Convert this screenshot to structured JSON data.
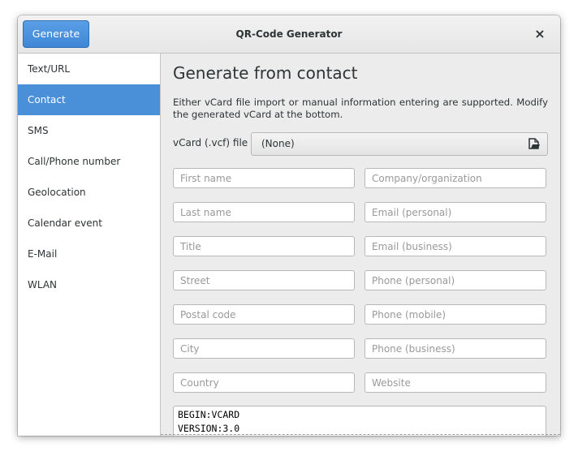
{
  "header": {
    "generate_label": "Generate",
    "title": "QR-Code Generator",
    "close_glyph": "×"
  },
  "sidebar": {
    "items": [
      {
        "label": "Text/URL"
      },
      {
        "label": "Contact",
        "active": true
      },
      {
        "label": "SMS"
      },
      {
        "label": "Call/Phone number"
      },
      {
        "label": "Geolocation"
      },
      {
        "label": "Calendar event"
      },
      {
        "label": "E-Mail"
      },
      {
        "label": "WLAN"
      }
    ]
  },
  "main": {
    "heading": "Generate from contact",
    "description": "Either vCard file import or manual information entering are supported. Modify the generated vCard at the bottom.",
    "vcf_label": "vCard (.vcf) file",
    "vcf_value": "(None)",
    "vcf_icon": "document-open-icon",
    "fields_left": [
      {
        "placeholder": "First name"
      },
      {
        "placeholder": "Last name"
      },
      {
        "placeholder": "Title"
      },
      {
        "placeholder": "Street"
      },
      {
        "placeholder": "Postal code"
      },
      {
        "placeholder": "City"
      },
      {
        "placeholder": "Country"
      }
    ],
    "fields_right": [
      {
        "placeholder": "Company/organization"
      },
      {
        "placeholder": "Email (personal)"
      },
      {
        "placeholder": "Email (business)"
      },
      {
        "placeholder": "Phone (personal)"
      },
      {
        "placeholder": "Phone (mobile)"
      },
      {
        "placeholder": "Phone (business)"
      },
      {
        "placeholder": "Website"
      }
    ],
    "vcard_text": "BEGIN:VCARD\nVERSION:3.0"
  },
  "colors": {
    "accent": "#4a90d9",
    "window_bg": "#ececec",
    "text": "#2e3436"
  }
}
